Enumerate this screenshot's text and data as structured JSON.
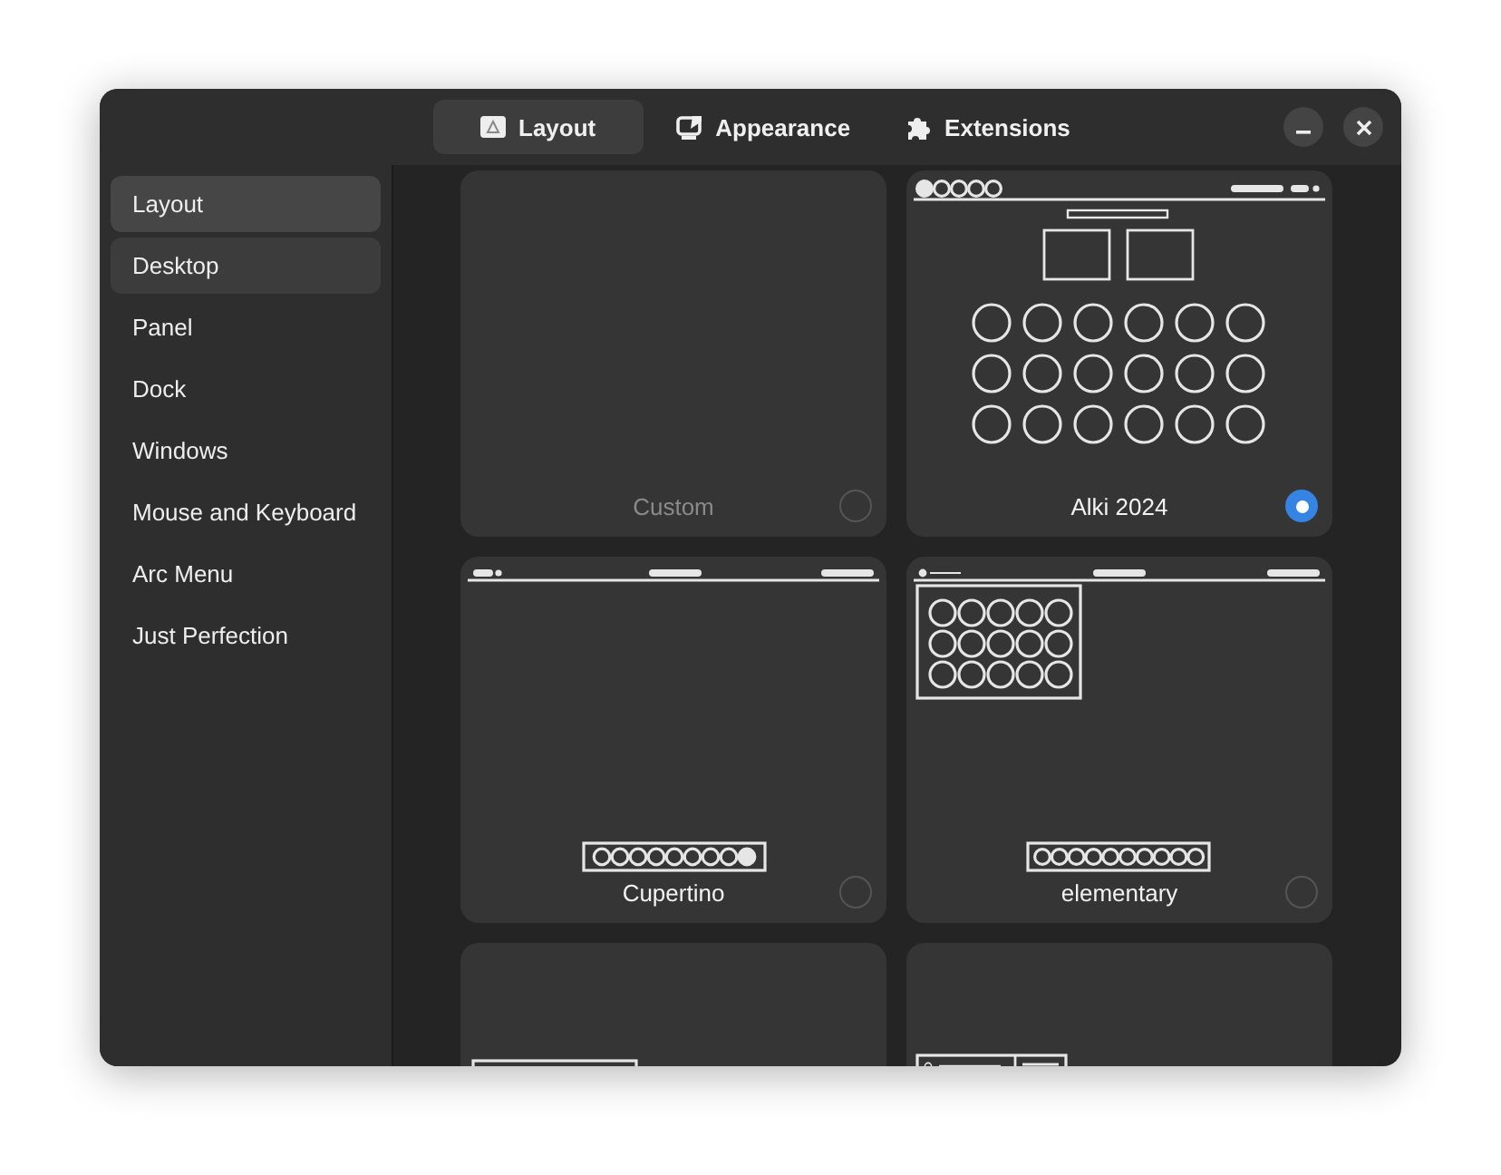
{
  "header": {
    "tabs": [
      {
        "label": "Layout",
        "kind": "layout",
        "selected": true
      },
      {
        "label": "Appearance",
        "kind": "appearance",
        "selected": false
      },
      {
        "label": "Extensions",
        "kind": "extensions",
        "selected": false
      }
    ]
  },
  "sidebar": {
    "items": [
      {
        "label": "Layout",
        "selected": true,
        "hover": false
      },
      {
        "label": "Desktop",
        "selected": false,
        "hover": true
      },
      {
        "label": "Panel",
        "selected": false,
        "hover": false
      },
      {
        "label": "Dock",
        "selected": false,
        "hover": false
      },
      {
        "label": "Windows",
        "selected": false,
        "hover": false
      },
      {
        "label": "Mouse and Keyboard",
        "selected": false,
        "hover": false
      },
      {
        "label": "Arc Menu",
        "selected": false,
        "hover": false
      },
      {
        "label": "Just Perfection",
        "selected": false,
        "hover": false
      }
    ]
  },
  "layouts": [
    {
      "kind": "custom",
      "label": "Custom",
      "disabled": true,
      "selected": false
    },
    {
      "kind": "alki",
      "label": "Alki 2024",
      "disabled": false,
      "selected": true
    },
    {
      "kind": "cupertino",
      "label": "Cupertino",
      "disabled": false,
      "selected": false
    },
    {
      "kind": "elementary",
      "label": "elementary",
      "disabled": false,
      "selected": false
    },
    {
      "kind": "window-box"
    },
    {
      "kind": "split-box"
    }
  ]
}
